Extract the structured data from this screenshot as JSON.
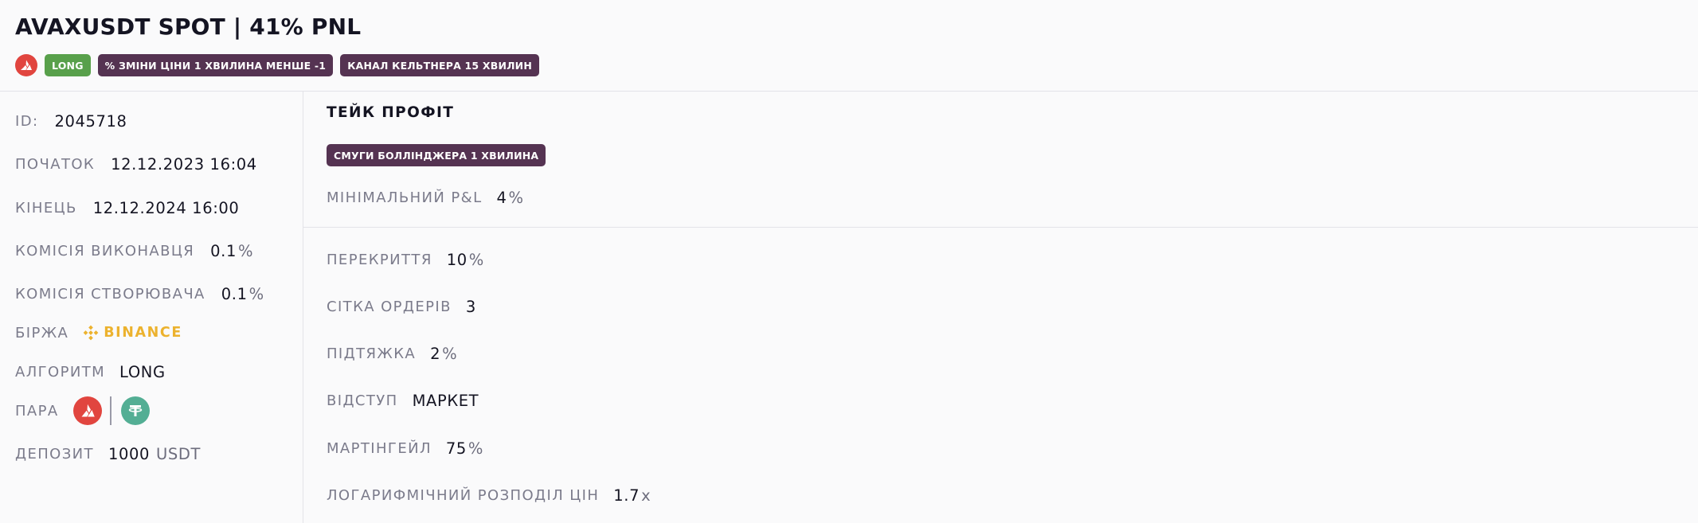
{
  "header": {
    "title": "AVAXUSDT SPOT | 41% PNL",
    "tags": [
      "LONG",
      "% ЗМІНИ ЦІНИ 1 ХВИЛИНА МЕНШЕ -1",
      "КАНАЛ КЕЛЬТНЕРА 15 ХВИЛИН"
    ],
    "coin_icon": "avax-icon"
  },
  "details": {
    "id_label": "ID:",
    "id_value": "2045718",
    "start_label": "ПОЧАТОК",
    "start_value": "12.12.2023 16:04",
    "end_label": "КІНЕЦЬ",
    "end_value": "12.12.2024 16:00",
    "maker_fee_label": "КОМІСІЯ ВИКОНАВЦЯ",
    "maker_fee_value": "0.1",
    "maker_fee_unit": "%",
    "taker_fee_label": "КОМІСІЯ СТВОРЮВАЧА",
    "taker_fee_value": "0.1",
    "taker_fee_unit": "%",
    "exchange_label": "БІРЖА",
    "exchange_value": "BINANCE",
    "algorithm_label": "АЛГОРИТМ",
    "algorithm_value": "LONG",
    "pair_label": "ПАРА",
    "pair_icons": [
      "avax-icon",
      "usdt-icon"
    ],
    "deposit_label": "ДЕПОЗИТ",
    "deposit_value": "1000",
    "deposit_unit": "USDT"
  },
  "take_profit": {
    "title": "ТЕЙК ПРОФІТ",
    "tag": "СМУГИ БОЛЛІНДЖЕРА 1 ХВИЛИНА",
    "min_pnl_label": "МІНІМАЛЬНИЙ P&L",
    "min_pnl_value": "4",
    "min_pnl_unit": "%"
  },
  "settings": {
    "overlap_label": "ПЕРЕКРИТТЯ",
    "overlap_value": "10",
    "overlap_unit": "%",
    "grid_label": "СІТКА ОРДЕРІВ",
    "grid_value": "3",
    "pullup_label": "ПІДТЯЖКА",
    "pullup_value": "2",
    "pullup_unit": "%",
    "indent_label": "ВІДСТУП",
    "indent_value": "МАРКЕТ",
    "martingale_label": "МАРТІНГЕЙЛ",
    "martingale_value": "75",
    "martingale_unit": "%",
    "log_label": "ЛОГАРИФМІЧНИЙ РОЗПОДІЛ ЦІН",
    "log_value": "1.7",
    "log_unit": "x"
  },
  "colors": {
    "avax": "#e1453f",
    "usdt": "#53ae94",
    "binance": "#ecb22e",
    "tag_purple": "#553352",
    "tag_green": "#58a04b"
  }
}
